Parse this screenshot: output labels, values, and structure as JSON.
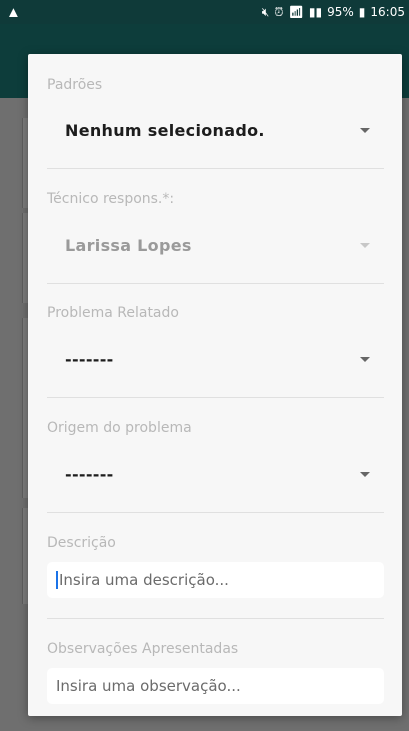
{
  "status_bar": {
    "warning_icon": "warning-icon",
    "battery": "95%",
    "time": "16:05"
  },
  "dialog": {
    "padroes": {
      "label": "Padrões",
      "value": "Nenhum selecionado."
    },
    "tecnico": {
      "label": "Técnico respons.*:",
      "value": "Larissa Lopes"
    },
    "problema": {
      "label": "Problema Relatado",
      "value": "-------"
    },
    "origem": {
      "label": "Origem do problema",
      "value": "-------"
    },
    "descricao": {
      "label": "Descrição",
      "placeholder": "Insira uma descrição..."
    },
    "observacoes": {
      "label": "Observações Apresentadas",
      "placeholder": "Insira uma observação..."
    }
  }
}
